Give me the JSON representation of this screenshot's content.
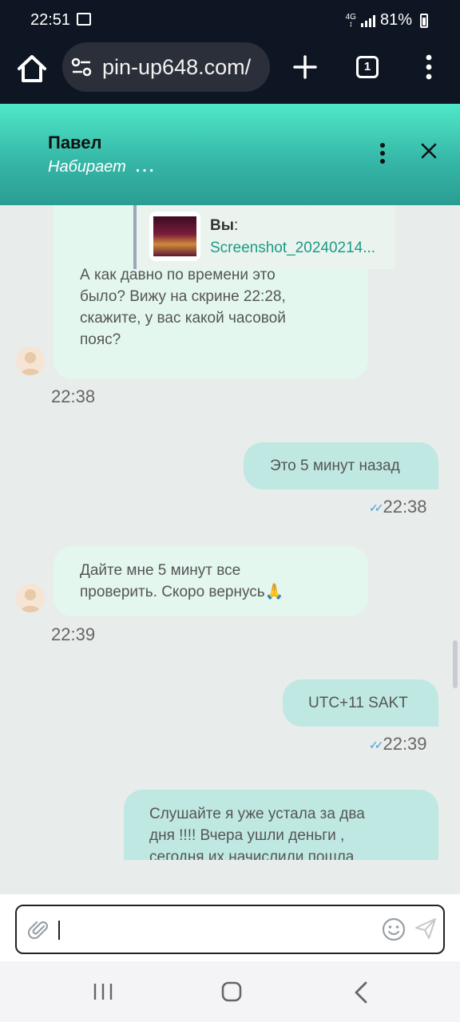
{
  "status_bar": {
    "time": "22:51",
    "network": "4G",
    "battery": "81%"
  },
  "browser": {
    "url": "pin-up648.com/",
    "tab_count": "1"
  },
  "chat_header": {
    "agent_name": "Павел",
    "status": "Набирает",
    "typing_dots": "..."
  },
  "messages": [
    {
      "direction": "incoming",
      "reply_preview": {
        "author": "Вы",
        "author_suffix": ":",
        "file": "Screenshot_20240214..."
      },
      "lines": [
        "А как давно по времени это",
        "было? Вижу на скрине 22:28,",
        "скажите, у вас какой часовой",
        "пояс?"
      ],
      "time": "22:38"
    },
    {
      "direction": "outgoing",
      "lines": [
        "Это 5 минут назад"
      ],
      "time": "22:38"
    },
    {
      "direction": "incoming",
      "lines": [
        "Дайте мне 5 минут все",
        "проверить. Скоро вернусь🙏"
      ],
      "time": "22:39"
    },
    {
      "direction": "outgoing",
      "lines": [
        "UTC+11 SAKT"
      ],
      "time": "22:39"
    },
    {
      "direction": "outgoing",
      "lines": [
        "Слушайте я уже устала за два",
        "дня !!!! Вчера ушли деньги ,",
        "сегодня их начислили пошла"
      ]
    }
  ],
  "composer": {
    "value": ""
  }
}
